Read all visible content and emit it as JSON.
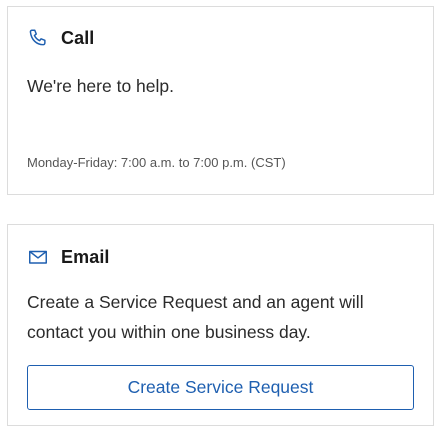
{
  "call": {
    "icon": "phone-icon",
    "title": "Call",
    "message": "We're here to help.",
    "hours": "Monday-Friday: 7:00 a.m. to 7:00 p.m. (CST)"
  },
  "email": {
    "icon": "mail-icon",
    "title": "Email",
    "message": "Create a Service Request and an agent will contact you within one business day.",
    "button_label": "Create Service Request"
  },
  "colors": {
    "accent": "#1e5fb0",
    "border": "#dcdcdc",
    "text": "#2b2b2b"
  }
}
